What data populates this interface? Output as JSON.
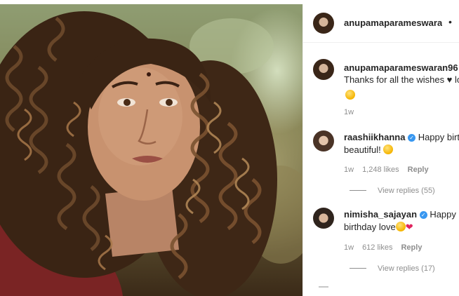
{
  "post": {
    "author": "anupamaparameswaran96",
    "header_separator": "•"
  },
  "caption": {
    "author": "anupamaparameswaran96",
    "text_line1": "Thanks for all the wishes ♥ lo",
    "time": "1w"
  },
  "comments": [
    {
      "username": "raashiikhanna",
      "verified": true,
      "text_line1": "Happy birth",
      "text_line2": "beautiful!",
      "time": "1w",
      "likes": "1,248 likes",
      "reply_label": "Reply",
      "view_replies": "View replies (55)"
    },
    {
      "username": "nimisha_sajayan",
      "verified": true,
      "text_line1": "Happy",
      "text_line2": "birthday love",
      "time": "1w",
      "likes": "612 likes",
      "reply_label": "Reply",
      "view_replies": "View replies (17)"
    }
  ],
  "icons": {
    "verified": "verified-badge-icon",
    "heart": "heart-emoji-icon",
    "emoji": "smiling-face-emoji-icon"
  },
  "colors": {
    "verified": "#3897f0",
    "muted": "#8e8e8e",
    "heart": "#e0245e"
  }
}
